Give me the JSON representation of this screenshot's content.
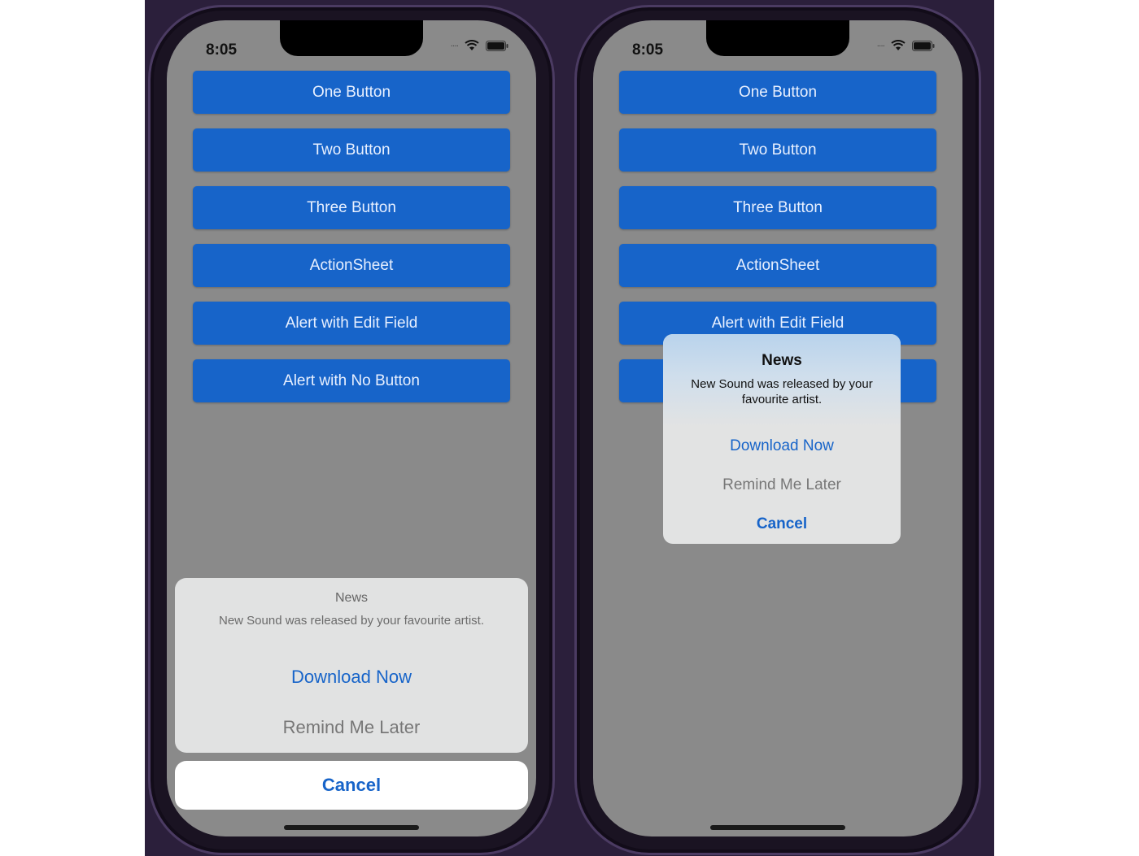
{
  "phones": [
    {
      "status": {
        "time": "8:05"
      },
      "buttons": [
        "One Button",
        "Two Button",
        "Three Button",
        "ActionSheet",
        "Alert with Edit Field",
        "Alert with No Button"
      ],
      "action_sheet": {
        "title": "News",
        "message": "New Sound was released by your favourite artist.",
        "actions": [
          "Download Now",
          "Remind Me Later"
        ],
        "cancel": "Cancel"
      }
    },
    {
      "status": {
        "time": "8:05"
      },
      "buttons": [
        "One Button",
        "Two Button",
        "Three Button",
        "ActionSheet",
        "Alert with Edit Field",
        ""
      ],
      "alert": {
        "title": "News",
        "message": "New Sound was released by your favourite artist.",
        "actions": [
          "Download Now",
          "Remind Me Later",
          "Cancel"
        ]
      }
    }
  ],
  "colors": {
    "button_blue": "#1764c9",
    "screen_dim": "#8a8a8a",
    "sheet_bg": "#e1e2e2"
  }
}
